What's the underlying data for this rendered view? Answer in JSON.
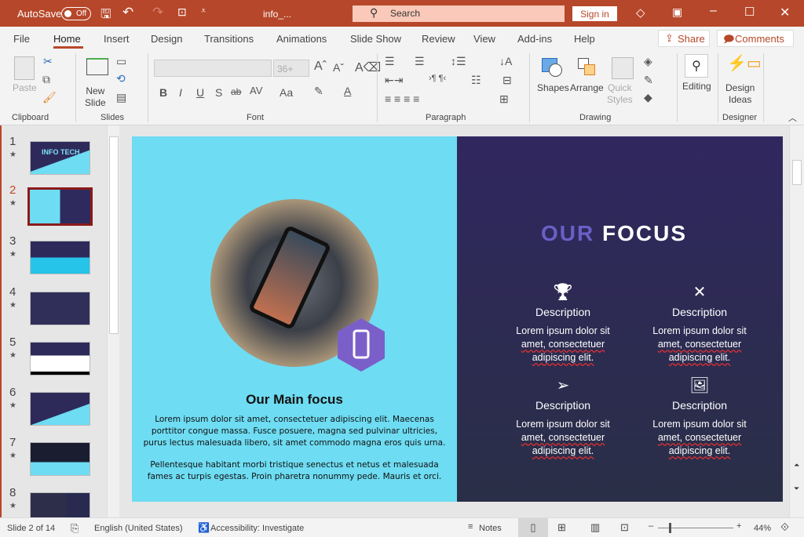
{
  "titlebar": {
    "autosave": "AutoSave",
    "toggle": "Off",
    "filename": "info_...",
    "search_placeholder": "Search",
    "signin": "Sign in",
    "bg": "#b7472a"
  },
  "tabs": [
    "File",
    "Home",
    "Insert",
    "Design",
    "Transitions",
    "Animations",
    "Slide Show",
    "Review",
    "View",
    "Add-ins",
    "Help"
  ],
  "share": "Share",
  "comments": "Comments",
  "ribbon": {
    "paste": "Paste",
    "new_slide_1": "New",
    "new_slide_2": "Slide",
    "font_size": "36+",
    "shapes": "Shapes",
    "arrange": "Arrange",
    "quick_1": "Quick",
    "quick_2": "Styles",
    "editing": "Editing",
    "design_1": "Design",
    "design_2": "Ideas",
    "groups": [
      "Clipboard",
      "Slides",
      "Font",
      "Paragraph",
      "Drawing",
      "Designer"
    ],
    "font_buttons": [
      "B",
      "I",
      "U",
      "S",
      "ab",
      "AV",
      "Aa"
    ]
  },
  "thumbnails": [
    {
      "n": "1",
      "title": "INFO TECH"
    },
    {
      "n": "2"
    },
    {
      "n": "3"
    },
    {
      "n": "4"
    },
    {
      "n": "5"
    },
    {
      "n": "6"
    },
    {
      "n": "7"
    },
    {
      "n": "8"
    }
  ],
  "selected_slide": 2,
  "slide": {
    "left_title": "Our Main focus",
    "left_p1": [
      "Lorem ipsum dolor sit amet, consectetuer adipiscing elit. Maecenas",
      "porttitor congue massa. Fusce posuere, magna sed pulvinar ultricies,",
      "purus lectus malesuada libero, sit amet commodo magna eros quis urna."
    ],
    "left_p2": [
      "Pellentesque habitant morbi tristique senectus et netus et malesuada",
      "fames ac turpis egestas. Proin pharetra nonummy pede. Mauris et orci."
    ],
    "heading_a": "OUR",
    "heading_b": "FOCUS",
    "items": [
      {
        "icon": "trophy-icon",
        "title": "Description",
        "l1": "Lorem ipsum dolor sit",
        "l2": "amet, consectetuer",
        "l3": "adipiscing elit."
      },
      {
        "icon": "tools-icon",
        "title": "Description",
        "l1": "Lorem ipsum dolor sit",
        "l2": "amet, consectetuer",
        "l3": "adipiscing elit."
      },
      {
        "icon": "paper-plane-icon",
        "title": "Description",
        "l1": "Lorem ipsum dolor sit",
        "l2": "amet, consectetuer",
        "l3": "adipiscing elit."
      },
      {
        "icon": "image-icon",
        "title": "Description",
        "l1": "Lorem ipsum dolor sit",
        "l2": "amet, consectetuer",
        "l3": "adipiscing elit."
      }
    ],
    "colors": {
      "left_bg": "#6edcf2",
      "right_bg": "#30275f",
      "accent": "#6b5fc7"
    }
  },
  "status": {
    "slide": "Slide 2 of 14",
    "language": "English (United States)",
    "accessibility": "Accessibility: Investigate",
    "notes": "Notes",
    "zoom": "44%"
  }
}
